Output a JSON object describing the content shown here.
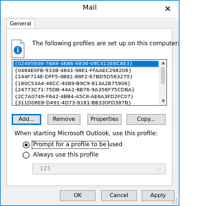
{
  "window": {
    "title": "Mail",
    "close_glyph": "✕"
  },
  "tabs": [
    {
      "label": "General",
      "selected": true
    }
  ],
  "intro_text": "The following profiles are set up on this computer:",
  "profiles": [
    {
      "name": "{02495608-7B88-46B6-8836-09C413E8C8E3}",
      "selected": true
    },
    {
      "name": "{0484E0FB-933B-4841-98E1-FFAAEC298206}",
      "selected": false
    },
    {
      "name": "{144F714E-DFF5-4B61-88F2-67BD5D563270}",
      "selected": false
    },
    {
      "name": "{180C53A4-46CC-40B9-B9C9-813A2B75906}",
      "selected": false
    },
    {
      "name": "{24773C71-75DB-44A1-8B76-9A356F75CDBA}",
      "selected": false
    },
    {
      "name": "{2C7A0749-F642-4BB4-A5C8-AE8A3FD2FC07}",
      "selected": false
    },
    {
      "name": "{311D06E8-D491-4D73-8181-BB330FD387B}",
      "selected": false
    }
  ],
  "buttons": {
    "add": "Add...",
    "remove": "Remove",
    "properties": "Properties",
    "copy": "Copy...",
    "ok": "OK",
    "cancel": "Cancel",
    "apply": "Apply"
  },
  "startup_label": "When starting Microsoft Outlook, use this profile:",
  "options": {
    "prompt_label": "Prompt for a profile to be used",
    "always_label": "Always use this profile",
    "selected": "prompt"
  },
  "profile_dropdown_value": "123",
  "colors": {
    "accent": "#0078d7",
    "window_border": "#1883d7"
  },
  "icons": {
    "info": "document-info-icon",
    "close": "close-icon",
    "dropdown": "chevron-down-icon"
  }
}
